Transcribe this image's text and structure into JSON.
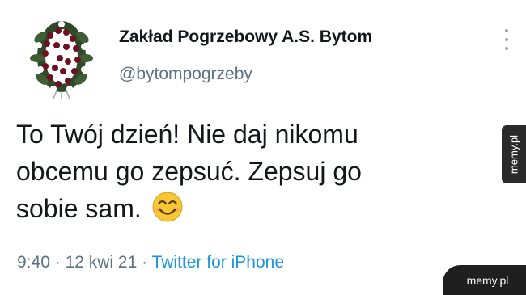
{
  "tweet": {
    "display_name": "Zakład Pogrzebowy A.S. Bytom",
    "handle": "@bytompogrzeby",
    "avatar_icon": "funeral-wreath-icon",
    "more_icon": "more-vertical-icon",
    "text_lines": [
      "To Twój dzień! Nie daj nikomu",
      "obcemu go zepsuć. Zepsuj go",
      "sobie sam."
    ],
    "emoji": "smiling-face-icon",
    "time": "9:40",
    "separator": "·",
    "date": "12 kwi 21",
    "source": "Twitter for iPhone"
  },
  "watermark": {
    "side": "memy.pl",
    "corner": "memy.pl"
  },
  "colors": {
    "text": "#14171a",
    "secondary": "#5b7083",
    "link": "#1b95e0"
  }
}
